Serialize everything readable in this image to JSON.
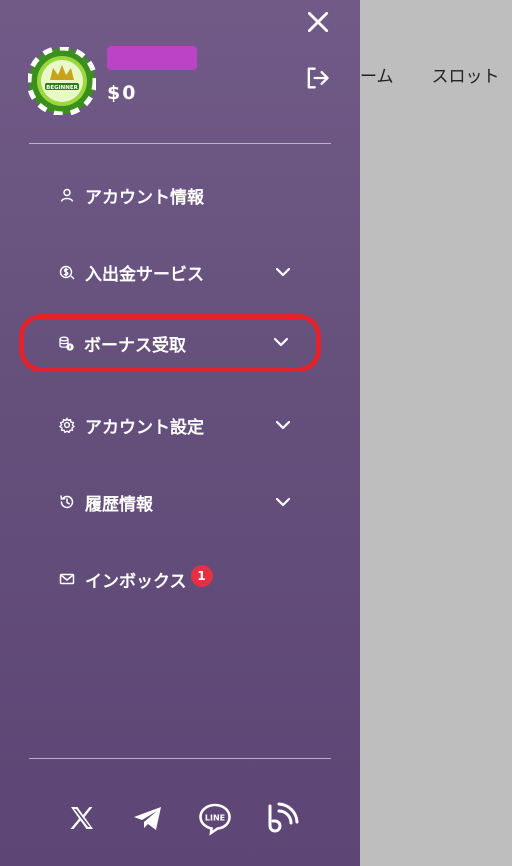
{
  "background_nav": [
    "ーム",
    "スロット"
  ],
  "user": {
    "name": "",
    "balance": "$0",
    "level_badge": "BEGINNER"
  },
  "menu": [
    {
      "label": "アカウント情報",
      "icon": "user-icon",
      "has_chevron": false
    },
    {
      "label": "入出金サービス",
      "icon": "money-icon",
      "has_chevron": true
    },
    {
      "label": "ボーナス受取",
      "icon": "coins-icon",
      "has_chevron": true,
      "highlighted": true
    },
    {
      "label": "アカウント設定",
      "icon": "gear-icon",
      "has_chevron": true
    },
    {
      "label": "履歴情報",
      "icon": "history-icon",
      "has_chevron": true
    },
    {
      "label": "インボックス",
      "icon": "mail-icon",
      "has_chevron": false,
      "badge": "1"
    }
  ],
  "social": [
    "x-icon",
    "telegram-icon",
    "line-icon",
    "blog-icon"
  ],
  "colors": {
    "drawer_top": "#715a87",
    "drawer_bottom": "#5d4575",
    "highlight": "#e2222c",
    "badge": "#e33044",
    "name_mask": "#bb44c6"
  }
}
